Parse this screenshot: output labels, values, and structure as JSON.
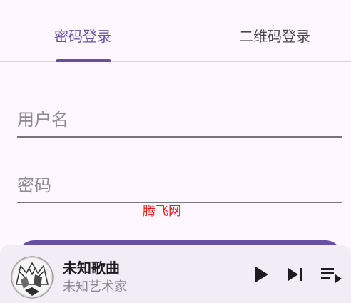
{
  "tabs": [
    {
      "label": "密码登录",
      "active": true
    },
    {
      "label": "二维码登录",
      "active": false
    }
  ],
  "form": {
    "username_placeholder": "用户名",
    "username_value": "",
    "password_placeholder": "密码",
    "password_value": ""
  },
  "watermark": "腾飞网",
  "player": {
    "title": "未知歌曲",
    "artist": "未知艺术家",
    "icons": [
      "album-art",
      "play-icon",
      "skip-next-icon",
      "queue-music-icon"
    ]
  },
  "colors": {
    "accent": "#6750a4",
    "background": "#fef7ff",
    "player_background": "#f2ecf6",
    "watermark": "#e02020"
  }
}
